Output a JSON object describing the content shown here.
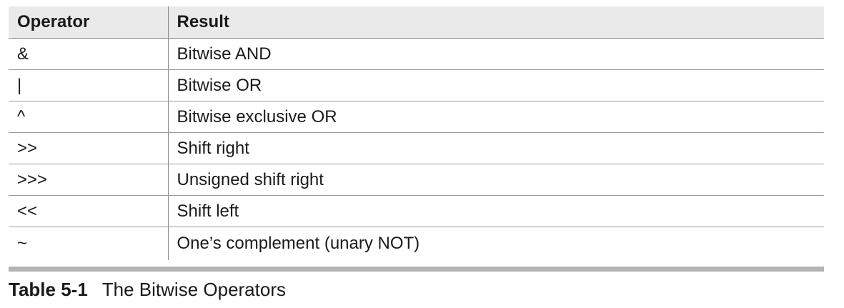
{
  "table": {
    "headers": {
      "operator": "Operator",
      "result": "Result"
    },
    "rows": [
      {
        "operator": "&",
        "result": "Bitwise AND"
      },
      {
        "operator": "|",
        "result": "Bitwise OR"
      },
      {
        "operator": "^",
        "result": "Bitwise exclusive OR"
      },
      {
        "operator": ">>",
        "result": "Shift right"
      },
      {
        "operator": ">>>",
        "result": "Unsigned shift right"
      },
      {
        "operator": "<<",
        "result": "Shift left"
      },
      {
        "operator": "~",
        "result": "One’s complement (unary NOT)"
      }
    ]
  },
  "caption": {
    "label": "Table 5-1",
    "title": "The Bitwise Operators"
  },
  "colors": {
    "header_background": "#eaeaea",
    "rule": "#b4b4b4"
  }
}
